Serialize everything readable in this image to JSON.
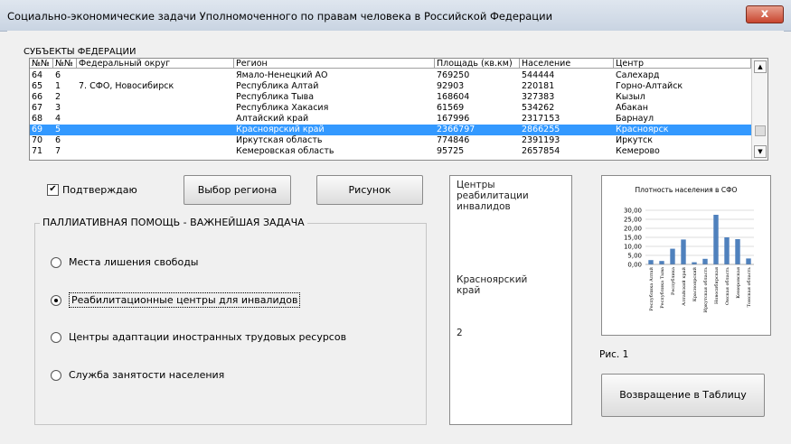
{
  "window": {
    "title": "Социально-экономические задачи Уполномоченного по правам человека в Российской Федерации",
    "close_glyph": "x"
  },
  "subjects": {
    "label": "СУБЪЕКТЫ ФЕДЕРАЦИИ",
    "columns": [
      "№№",
      "№№",
      "Федеральный округ",
      "Регион",
      "Площадь (кв.км)",
      "Население",
      "Центр"
    ],
    "rows": [
      {
        "n1": "64",
        "n2": "6",
        "okrug": "",
        "region": "Ямало-Ненецкий АО",
        "area": "769250",
        "pop": "544444",
        "center": "Салехард",
        "selected": false
      },
      {
        "n1": "65",
        "n2": "1",
        "okrug": "7. СФО, Новосибирск",
        "region": "Республика Алтай",
        "area": "92903",
        "pop": "220181",
        "center": "Горно-Алтайск",
        "selected": false
      },
      {
        "n1": "66",
        "n2": "2",
        "okrug": "",
        "region": "Республика Тыва",
        "area": "168604",
        "pop": "327383",
        "center": "Кызыл",
        "selected": false
      },
      {
        "n1": "67",
        "n2": "3",
        "okrug": "",
        "region": "Республика Хакасия",
        "area": "61569",
        "pop": "534262",
        "center": "Абакан",
        "selected": false
      },
      {
        "n1": "68",
        "n2": "4",
        "okrug": "",
        "region": "Алтайский край",
        "area": "167996",
        "pop": "2317153",
        "center": "Барнаул",
        "selected": false
      },
      {
        "n1": "69",
        "n2": "5",
        "okrug": "",
        "region": "Красноярский край",
        "area": "2366797",
        "pop": "2866255",
        "center": "Красноярск",
        "selected": true
      },
      {
        "n1": "70",
        "n2": "6",
        "okrug": "",
        "region": "Иркутская область",
        "area": "774846",
        "pop": "2391193",
        "center": "Иркутск",
        "selected": false
      },
      {
        "n1": "71",
        "n2": "7",
        "okrug": "",
        "region": "Кемеровская область",
        "area": "95725",
        "pop": "2657854",
        "center": "Кемерово",
        "selected": false
      }
    ]
  },
  "controls": {
    "confirm_label": "Подтверждаю",
    "confirm_checked": true,
    "select_region_label": "Выбор региона",
    "picture_label": "Рисунок",
    "return_label": "Возвращение в Таблицу"
  },
  "palliative": {
    "group_label": "ПАЛЛИАТИВНАЯ ПОМОЩЬ - ВАЖНЕЙШАЯ ЗАДАЧА",
    "options": [
      {
        "label": "Места лишения свободы",
        "selected": false
      },
      {
        "label": "Реабилитационные центры для инвалидов",
        "selected": true
      },
      {
        "label": "Центры адаптации иностранных трудовых ресурсов",
        "selected": false
      },
      {
        "label": "Служба занятости населения",
        "selected": false
      }
    ]
  },
  "info": {
    "heading_lines": [
      "Центры",
      "реабилитации",
      "инвалидов"
    ],
    "region_lines": [
      "Красноярский",
      "край"
    ],
    "count": "2"
  },
  "figure_caption": "Рис. 1",
  "chart_data": {
    "type": "bar",
    "title": "Плотность населения в СФО",
    "categories": [
      "Республика Алтай",
      "Республика Тыва",
      "Республика",
      "Алтайский край",
      "Красноярский",
      "Иркутская область",
      "Новосибирская",
      "Омская область",
      "Кемеровская",
      "Томская область"
    ],
    "values": [
      2.4,
      1.9,
      8.7,
      13.8,
      1.2,
      3.1,
      27.5,
      15.0,
      14.0,
      3.3
    ],
    "ylim": [
      0,
      30
    ],
    "yticks": [
      "0,00",
      "5,00",
      "10,00",
      "15,00",
      "20,00",
      "25,00",
      "30,00"
    ],
    "ytick_values": [
      0,
      5,
      10,
      15,
      20,
      25,
      30
    ],
    "color": "#4f81bd",
    "grid": true
  }
}
